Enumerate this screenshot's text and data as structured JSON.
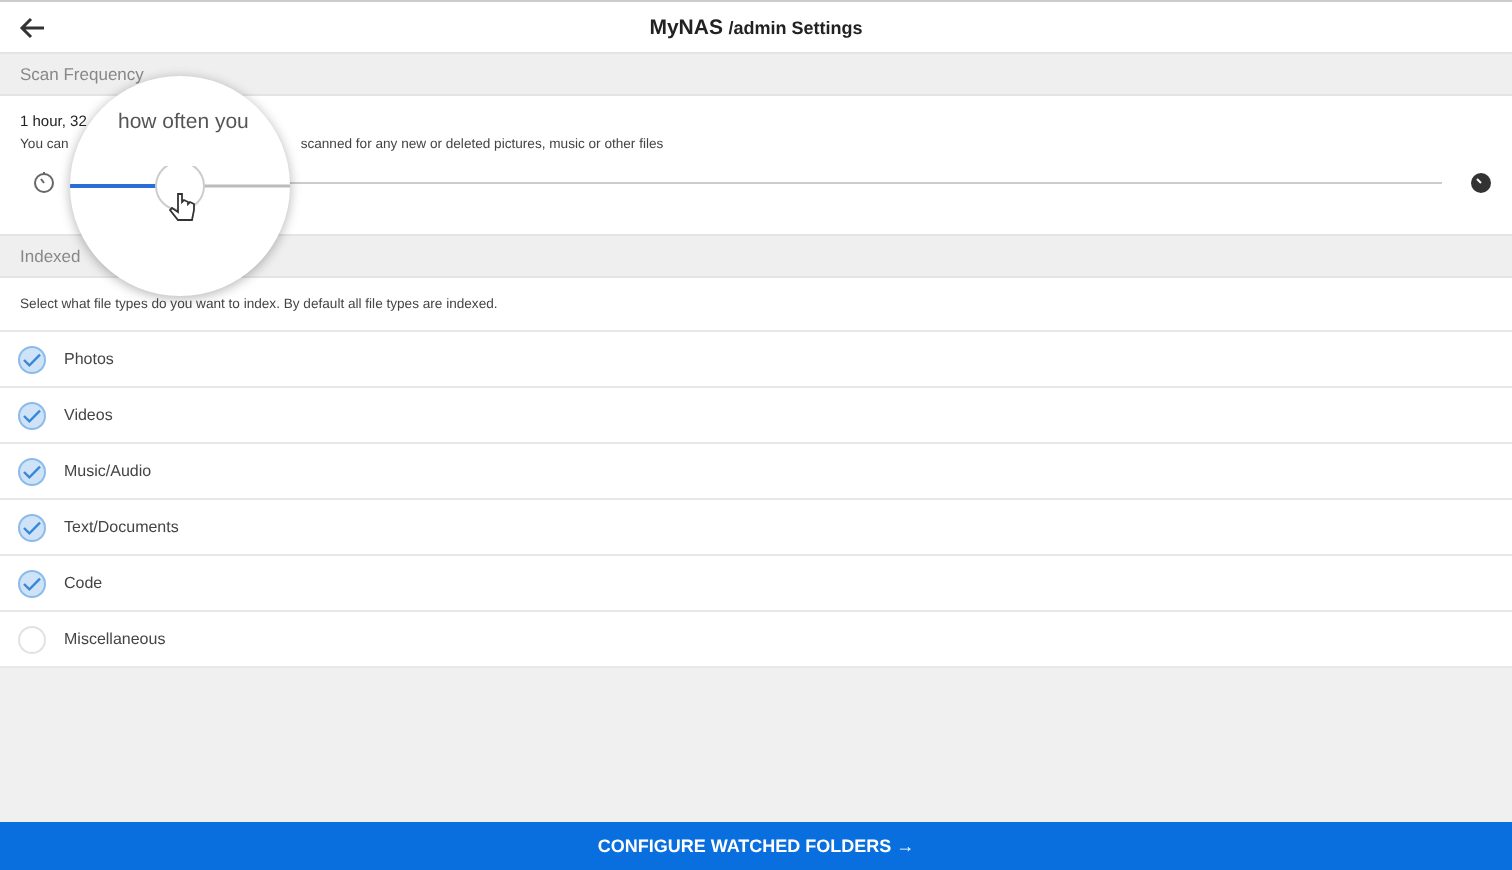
{
  "header": {
    "title": "MyNAS",
    "subtitle": "/admin Settings"
  },
  "scan": {
    "heading": "Scan Frequency",
    "value": "1 hour, 32",
    "desc_start": "You can",
    "desc_end": "scanned for any new or deleted pictures, music or other files",
    "level": 0.077
  },
  "magnifier": {
    "text": "how often you"
  },
  "indexed": {
    "heading": "Indexed",
    "desc": "Select what file types do you want to index. By default all file types are indexed.",
    "items": [
      {
        "label": "Photos",
        "checked": true
      },
      {
        "label": "Videos",
        "checked": true
      },
      {
        "label": "Music/Audio",
        "checked": true
      },
      {
        "label": "Text/Documents",
        "checked": true
      },
      {
        "label": "Code",
        "checked": true
      },
      {
        "label": "Miscellaneous",
        "checked": false
      }
    ]
  },
  "footer_button": {
    "label": "CONFIGURE WATCHED FOLDERS →"
  }
}
